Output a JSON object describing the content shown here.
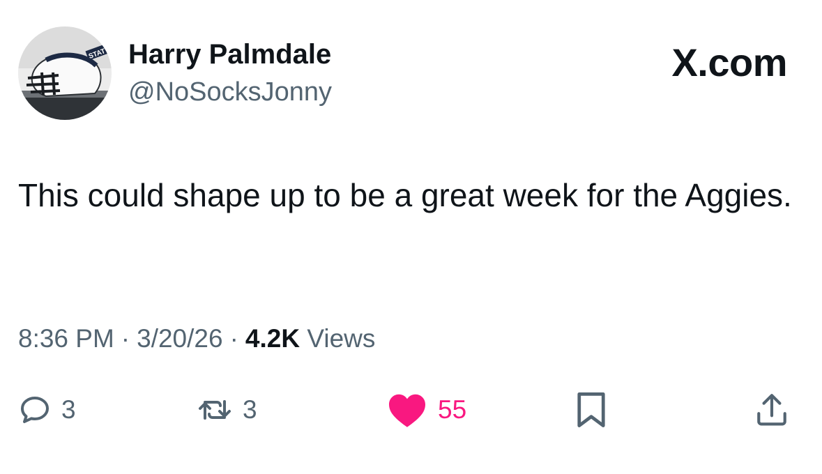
{
  "author": {
    "display_name": "Harry Palmdale",
    "handle": "@NoSocksJonny",
    "avatar_icon": "football-helmet-avatar"
  },
  "brand": {
    "label": "X.com"
  },
  "tweet": {
    "text": "This could shape up to be a great week for the Aggies."
  },
  "meta": {
    "time": "8:36 PM",
    "separator": "·",
    "date": "3/20/26",
    "views_count": "4.2K",
    "views_label": "Views"
  },
  "actions": {
    "reply": {
      "icon": "reply-icon",
      "count": "3"
    },
    "retweet": {
      "icon": "retweet-icon",
      "count": "3"
    },
    "like": {
      "icon": "heart-icon",
      "count": "55",
      "color": "#f91880",
      "liked": true
    },
    "bookmark": {
      "icon": "bookmark-icon"
    },
    "share": {
      "icon": "share-icon"
    }
  },
  "colors": {
    "text_primary": "#0f1419",
    "text_secondary": "#536471",
    "like": "#f91880",
    "background": "#ffffff"
  }
}
